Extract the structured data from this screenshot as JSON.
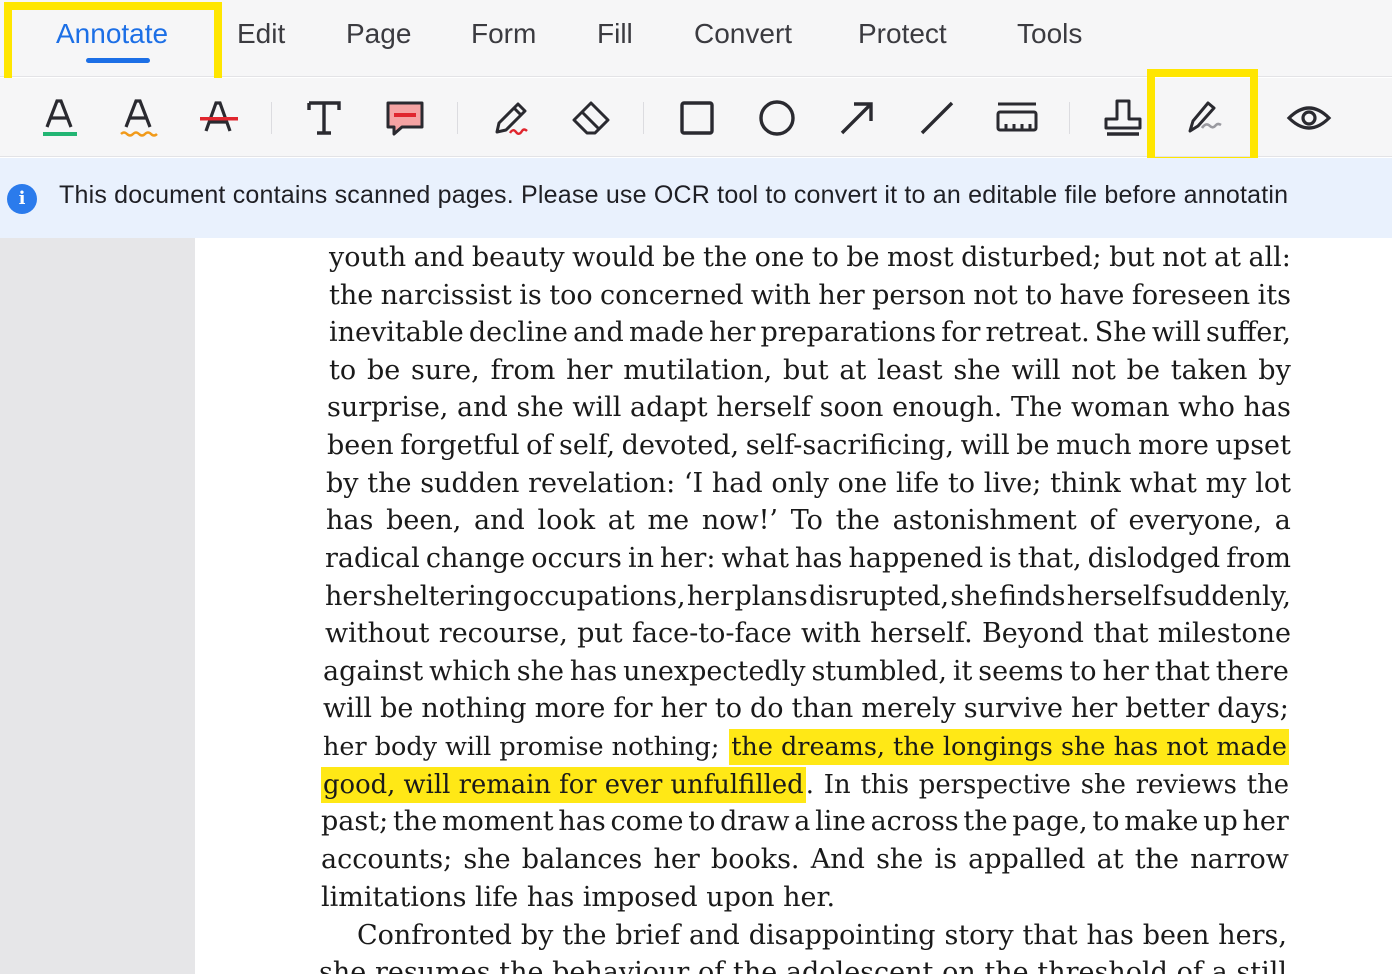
{
  "menu": {
    "items": [
      "Annotate",
      "Edit",
      "Page",
      "Form",
      "Fill",
      "Convert",
      "Protect",
      "Tools"
    ],
    "active": "Annotate"
  },
  "toolbar": {
    "tools": [
      {
        "name": "text-color-icon"
      },
      {
        "name": "squiggly-underline-icon"
      },
      {
        "name": "strikethrough-icon"
      },
      {
        "name": "text-box-icon"
      },
      {
        "name": "comment-icon"
      },
      {
        "name": "pencil-icon"
      },
      {
        "name": "eraser-icon"
      },
      {
        "name": "rectangle-icon"
      },
      {
        "name": "circle-icon"
      },
      {
        "name": "arrow-icon"
      },
      {
        "name": "line-icon"
      },
      {
        "name": "measure-icon"
      },
      {
        "name": "stamp-icon"
      },
      {
        "name": "signature-icon"
      },
      {
        "name": "eye-icon"
      }
    ],
    "highlighted": "signature-icon"
  },
  "banner": {
    "icon": "info-icon",
    "text": "This document contains scanned pages. Please use OCR tool to convert it to an editable file before annotatin"
  },
  "document": {
    "lines": [
      "youth and beauty would be the one to be most disturbed; but not at all:",
      "the narcissist is too concerned with her person not to have foreseen its",
      "inevitable decline and made her preparations for retreat. She will suffer,",
      "to be sure, from her mutilation, but at least she will not be taken by",
      "surprise, and she will adapt herself soon enough. The woman who has",
      "been forgetful of self, devoted, self-sacrificing, will be much more upset",
      "by the sudden revelation: ‘I had only one life to live; think what my lot",
      "has been, and look at me now!’ To the astonishment of everyone, a",
      "radical change occurs in her: what has happened is that, dislodged from",
      "her sheltering occupations, her plans disrupted, she finds herself suddenly,",
      "without recourse, put face-to-face with herself. Beyond that milestone",
      "against which she has unexpectedly stumbled, it seems to her that there",
      "will be nothing more for her to do than merely survive her better days;",
      "her body will promise nothing;",
      "the dreams, the longings she has not made",
      "good, will remain for ever unfulfilled",
      ". In this perspective she reviews the",
      "past; the moment has come to draw a line across the page, to make up her",
      "accounts; she balances her books. And she is appalled at the narrow",
      "limitations life has imposed upon her.",
      "Confronted by the brief and disappointing story that has been hers,",
      "she resumes the behaviour of the adolescent on the threshold of a still"
    ],
    "highlight_color": "#ffe816"
  },
  "colors": {
    "accent": "#1c6fe6",
    "highlight_box": "#ffe600",
    "banner_bg": "#e9f1fd",
    "info_icon": "#2b7bec"
  }
}
